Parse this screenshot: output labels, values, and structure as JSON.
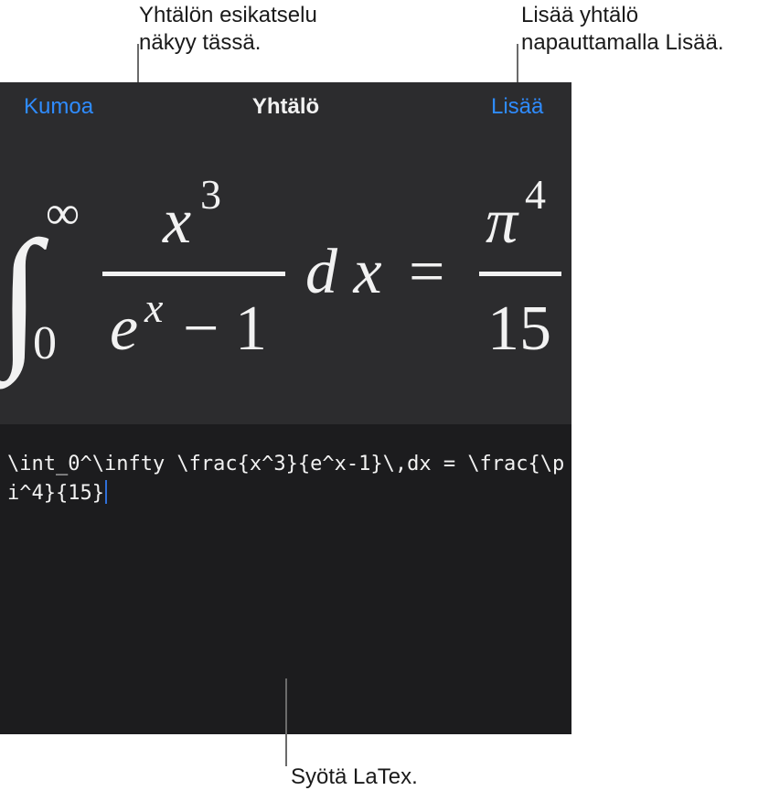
{
  "callouts": {
    "preview": {
      "line1": "Yhtälön esikatselu",
      "line2": "näkyy tässä."
    },
    "insert": {
      "line1": "Lisää yhtälö",
      "line2": "napauttamalla Lisää."
    },
    "latex": {
      "line1": "Syötä LaTex."
    }
  },
  "toolbar": {
    "cancel_label": "Kumoa",
    "title": "Yhtälö",
    "insert_label": "Lisää"
  },
  "equation": {
    "integral_sign": "∫",
    "upper_limit": "∞",
    "lower_limit": "0",
    "numerator_base": "x",
    "numerator_exp": "3",
    "denominator_base": "e",
    "denominator_exp": "x",
    "denominator_rest": "− 1",
    "differential": "d x",
    "equals": "=",
    "rhs_numerator_base": "π",
    "rhs_numerator_exp": "4",
    "rhs_denominator": "15"
  },
  "editor": {
    "latex_source": "\\int_0^\\infty \\frac{x^3}{e^x-1}\\,dx = \\frac{\\pi^4}{15}"
  },
  "colors": {
    "accent": "#2f8cff",
    "preview_bg": "#2c2c2e",
    "editor_bg": "#1c1c1e",
    "text_light": "#f2f2f2",
    "caret": "#2f6fd8"
  }
}
